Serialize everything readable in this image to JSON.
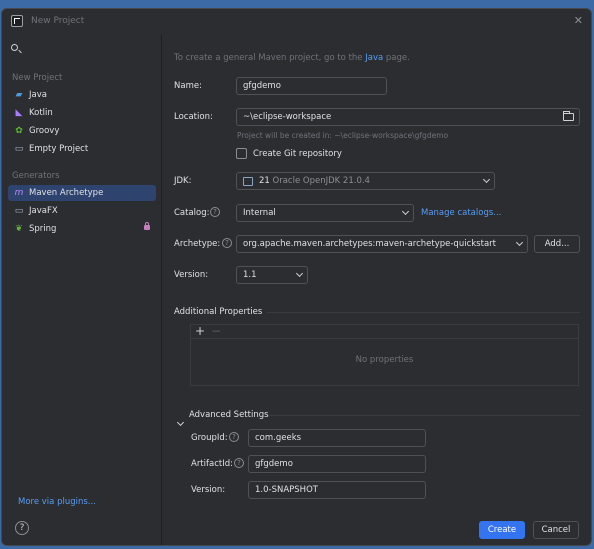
{
  "window": {
    "title": "New Project"
  },
  "sidebar": {
    "new_project_label": "New Project",
    "new_project_items": [
      {
        "label": "Java",
        "icon": "folder-icon",
        "color": "#4f9bd8"
      },
      {
        "label": "Kotlin",
        "icon": "kotlin-icon",
        "color": "#a97bff"
      },
      {
        "label": "Groovy",
        "icon": "groovy-icon",
        "color": "#5fb832"
      },
      {
        "label": "Empty Project",
        "icon": "empty-project-icon",
        "color": "#a9b7c6"
      }
    ],
    "generators_label": "Generators",
    "generator_items": [
      {
        "label": "Maven Archetype",
        "icon": "maven-icon",
        "color": "#a97bff",
        "selected": true
      },
      {
        "label": "JavaFX",
        "icon": "javafx-icon",
        "color": "#a9b7c6"
      },
      {
        "label": "Spring",
        "icon": "spring-icon",
        "color": "#6db33f",
        "locked": true
      }
    ],
    "more_plugins": "More via plugins..."
  },
  "main": {
    "intro_prefix": "To create a general Maven project, go to the ",
    "intro_link": "Java",
    "intro_suffix": " page.",
    "name_label": "Name:",
    "name_value": "gfgdemo",
    "location_label": "Location:",
    "location_value": "~\\eclipse-workspace",
    "location_hint": "Project will be created in: ~\\eclipse-workspace\\gfgdemo",
    "git_label": "Create Git repository",
    "jdk_label": "JDK:",
    "jdk_version": "21",
    "jdk_name": "Oracle OpenJDK 21.0.4",
    "catalog_label": "Catalog:",
    "catalog_value": "Internal",
    "manage_catalogs": "Manage catalogs...",
    "archetype_label": "Archetype:",
    "archetype_value": "org.apache.maven.archetypes:maven-archetype-quickstart",
    "add_button": "Add...",
    "version_label": "Version:",
    "version_value": "1.1",
    "additional_properties": "Additional Properties",
    "no_properties": "No properties",
    "advanced_settings": "Advanced Settings",
    "groupid_label": "GroupId:",
    "groupid_value": "com.geeks",
    "artifactid_label": "ArtifactId:",
    "artifactid_value": "gfgdemo",
    "adv_version_label": "Version:",
    "adv_version_value": "1.0-SNAPSHOT"
  },
  "footer": {
    "create": "Create",
    "cancel": "Cancel"
  },
  "colors": {
    "accent": "#3574f0",
    "link": "#589df6",
    "background": "#2b2d30"
  }
}
